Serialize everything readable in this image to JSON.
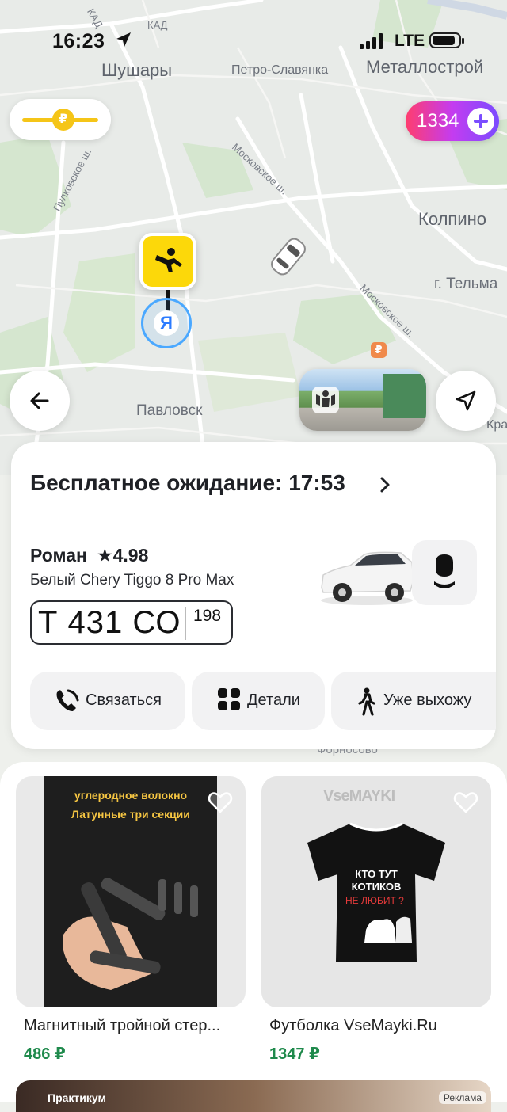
{
  "status_bar": {
    "time": "16:23",
    "network": "LTE"
  },
  "map": {
    "labels": {
      "kad1": "КАД",
      "kad2": "КАД",
      "shushary": "Шушары",
      "petro": "Петро-Славянка",
      "metallostroy": "Металлострой",
      "moskovskoe1": "Московское ш.",
      "moskovskoe2": "Московское ш.",
      "pulkovskoe": "Пулковское ш.",
      "kolpino": "Колпино",
      "telmana": "г. Тельма",
      "pavlovsk": "Павловск",
      "kra": "Кра"
    },
    "pickup_marker_letter": "Я",
    "ruble_poi": "₽"
  },
  "cashback_pill": {
    "coin": "₽"
  },
  "points_pill": {
    "value": "1334"
  },
  "driver_card": {
    "wait_title": "Бесплатное ожидание: 17:53",
    "driver_name": "Роман",
    "rating": "★4.98",
    "car_model": "Белый Chery Tiggo 8 Pro Max",
    "plate_main": "Т 431 СО",
    "plate_region": "198",
    "actions": {
      "contact": "Связаться",
      "details": "Детали",
      "coming_out": "Уже выхожу"
    }
  },
  "under_card_label": "Форносово",
  "ads": {
    "products": [
      {
        "title": "Магнитный тройной стер...",
        "price": "486 ₽",
        "image_text_1": "углеродное волокно",
        "image_text_2": "Латунные три секции"
      },
      {
        "title": "Футболка VseMayki.Ru",
        "price": "1347 ₽",
        "brand": "VseMAYKI",
        "shirt_line_1": "КТО ТУТ",
        "shirt_line_2": "КОТИКОВ",
        "shirt_line_3": "НЕ ЛЮБИТ ?"
      }
    ],
    "banner_text": "Практикум",
    "ad_tag": "Реклама"
  },
  "colors": {
    "yandex_yellow": "#fcd80a",
    "price_green": "#1f8a4c",
    "points_gradient_start": "#ff3d6e",
    "points_gradient_end": "#7a4cff"
  }
}
